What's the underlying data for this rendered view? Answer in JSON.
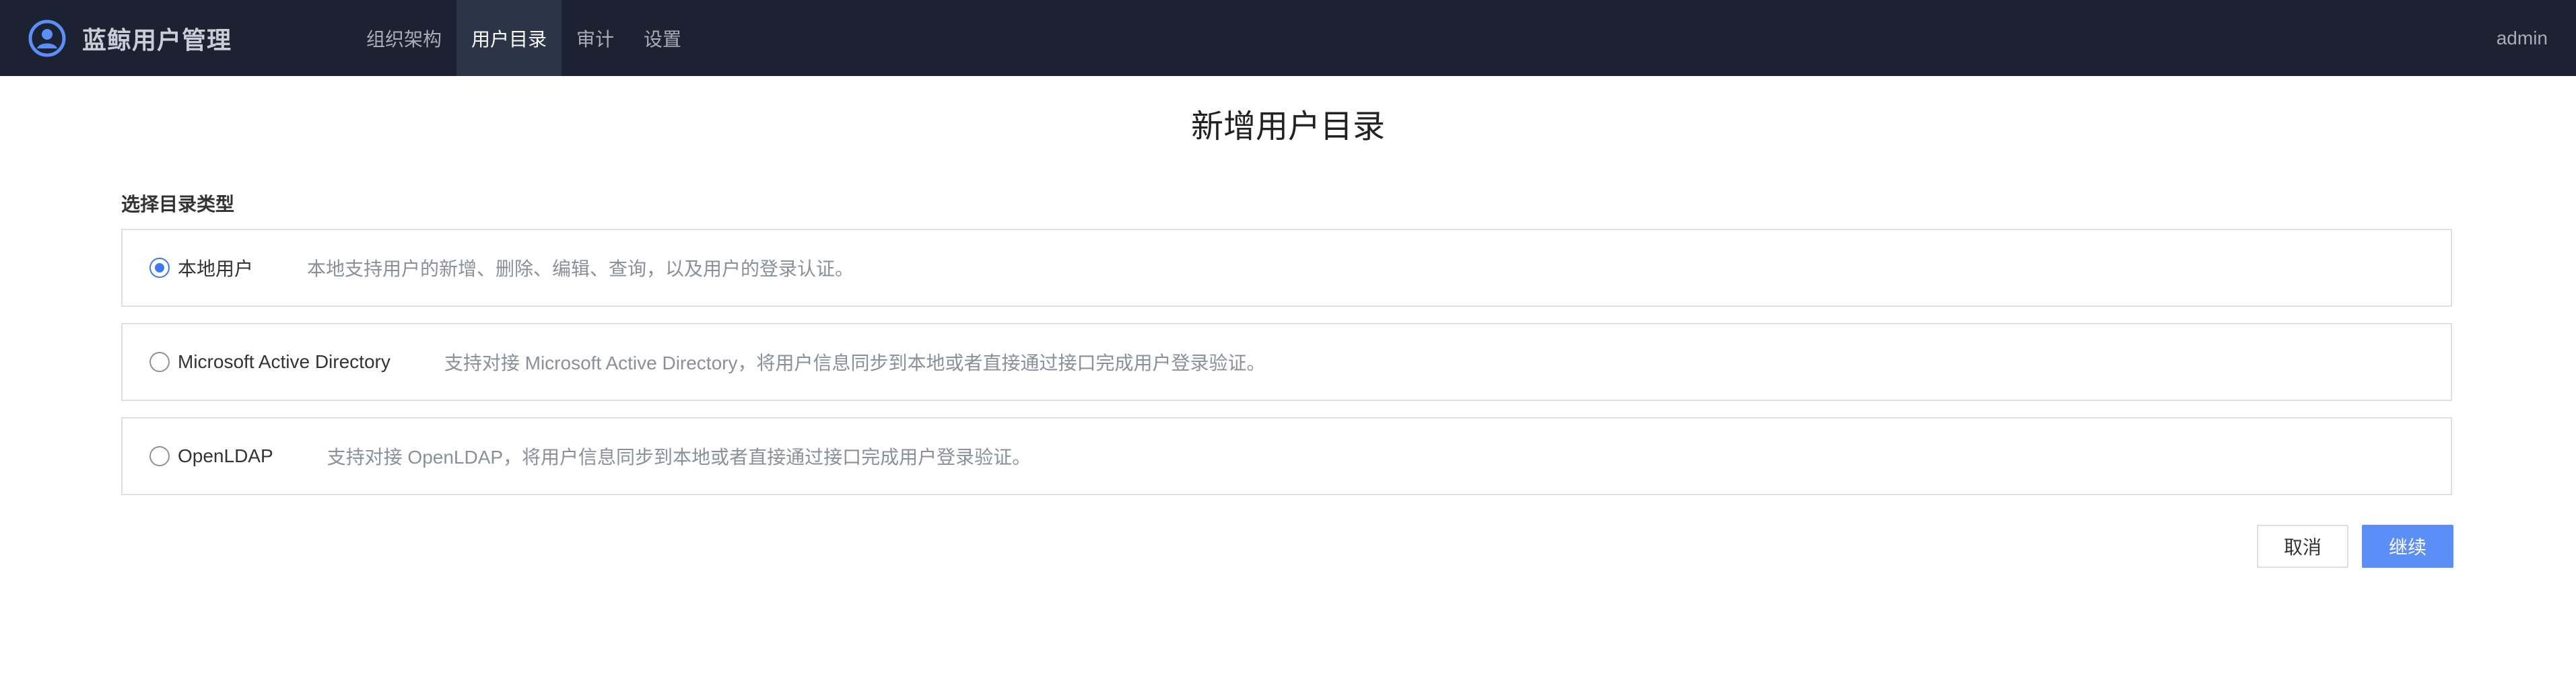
{
  "app": {
    "title": "蓝鲸用户管理",
    "logo_icon": "user-circle-icon"
  },
  "nav": {
    "items": [
      {
        "label": "组织架构",
        "active": false
      },
      {
        "label": "用户目录",
        "active": true
      },
      {
        "label": "审计",
        "active": false
      },
      {
        "label": "设置",
        "active": false
      }
    ]
  },
  "user": {
    "name": "admin"
  },
  "page": {
    "title": "新增用户目录",
    "section_label": "选择目录类型"
  },
  "options": [
    {
      "label": "本地用户",
      "description": "本地支持用户的新增、删除、编辑、查询，以及用户的登录认证。",
      "selected": true
    },
    {
      "label": "Microsoft Active Directory",
      "description": "支持对接 Microsoft Active Directory，将用户信息同步到本地或者直接通过接口完成用户登录验证。",
      "selected": false
    },
    {
      "label": "OpenLDAP",
      "description": "支持对接 OpenLDAP，将用户信息同步到本地或者直接通过接口完成用户登录验证。",
      "selected": false
    }
  ],
  "actions": {
    "cancel_label": "取消",
    "continue_label": "继续"
  },
  "colors": {
    "topbar": "#1d2233",
    "accent": "#3a7bf2",
    "primary_button": "#5b8ef7"
  }
}
